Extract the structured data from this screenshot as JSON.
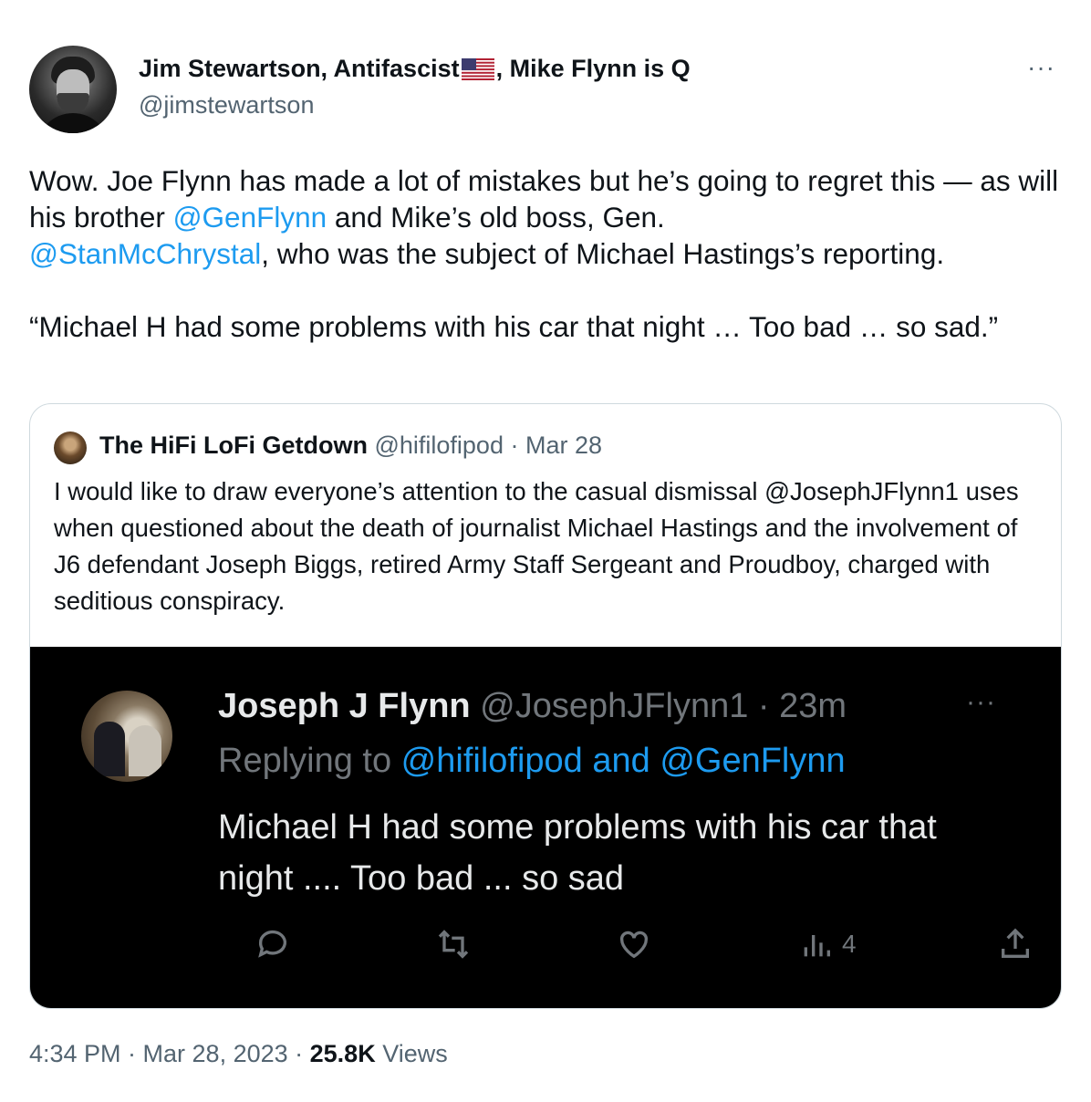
{
  "author": {
    "name_part1": "Jim Stewartson, Antifascist",
    "name_part2": ", Mike Flynn is Q",
    "flag_icon": "us-flag-emoji",
    "handle": "@jimstewartson"
  },
  "menu": {
    "more_label": "···"
  },
  "tweet": {
    "p1_t1": "Wow. Joe Flynn has made a lot of mistakes but he’s going to regret this — as will his brother ",
    "p1_link1": "@GenFlynn",
    "p1_t2": " and Mike’s old boss, Gen. ",
    "p1_link2": "@StanMcChrystal",
    "p1_t3": ", who was the subject of Michael Hastings’s reporting.",
    "p2": "“Michael H had some problems with his car that night … Too bad … so sad.”"
  },
  "quote": {
    "name": "The HiFi LoFi Getdown",
    "handle_date": " @hifilofipod · Mar 28",
    "text": "I would like to draw everyone’s attention to the casual dismissal @JosephJFlynn1 uses when questioned about the death of journalist Michael Hastings and the involvement of J6 defendant Joseph Biggs, retired Army Staff Sergeant and Proudboy, charged with seditious conspiracy.",
    "screenshot": {
      "name": "Joseph J Flynn",
      "handle_time": " @JosephJFlynn1 · 23m",
      "more_label": "···",
      "replying_prefix": "Replying to ",
      "replying_targets": "@hifilofipod and @GenFlynn",
      "text": "Michael H had some problems with his car that night .... Too bad ... so sad",
      "views_count": "4",
      "action_icons": [
        "reply-icon",
        "retweet-icon",
        "like-icon",
        "views-icon",
        "share-icon"
      ]
    }
  },
  "meta": {
    "time_date": "4:34 PM · Mar 28, 2023 · ",
    "views_count": "25.8K",
    "views_label": " Views"
  },
  "colors": {
    "link": "#1d9bf0",
    "secondary": "#536471",
    "border": "#cfd9de"
  }
}
